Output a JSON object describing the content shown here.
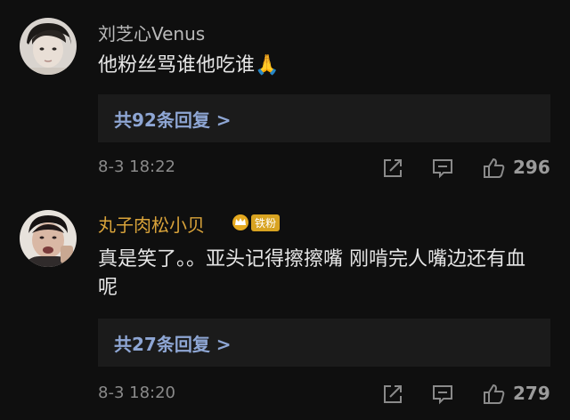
{
  "comments": [
    {
      "username": "刘芝心Venus",
      "username_color": "#b9b9b9",
      "text": "他粉丝骂谁他吃谁",
      "emoji": "🙏",
      "replies_label": "共92条回复 >",
      "timestamp": "8-3 18:22",
      "likes": "296",
      "avatar_icon": "avatar-photo"
    },
    {
      "username": "丸子肉松小贝",
      "username_color": "#d9a33a",
      "badge_label": "铁粉",
      "text": "真是笑了。。亚头记得擦擦嘴 刚啃完人嘴边还有血呢",
      "replies_label": "共27条回复 >",
      "timestamp": "8-3 18:20",
      "likes": "279",
      "avatar_icon": "avatar-photo"
    }
  ],
  "colors": {
    "background": "#0f0f0f",
    "reply_box": "#1b1b1b",
    "link": "#8ea6d4",
    "meta": "#8a8a8a",
    "fan_badge": "#d8a321"
  },
  "icons": [
    "share-icon",
    "comment-icon",
    "like-icon",
    "crown-icon"
  ]
}
